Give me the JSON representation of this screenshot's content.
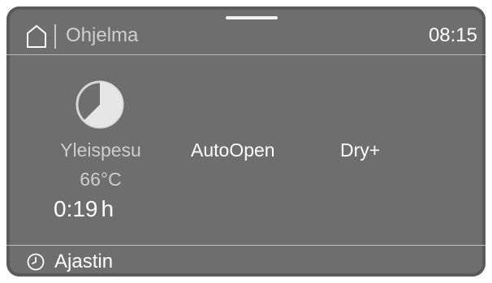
{
  "header": {
    "title": "Ohjelma",
    "time": "08:15",
    "home_icon": "home-icon"
  },
  "program": {
    "icon": "partial-pie-icon",
    "name": "Yleispesu",
    "temperature": "66°C",
    "duration": "0:19",
    "duration_unit": "h"
  },
  "options": [
    {
      "label": "AutoOpen"
    },
    {
      "label": "Dry+"
    }
  ],
  "footer": {
    "icon": "clock-icon",
    "label": "Ajastin"
  },
  "colors": {
    "screen_bg": "#6e6e6e",
    "text_primary": "#ffffff",
    "text_dim": "#cdcdcd",
    "divider": "#bdbdbd"
  }
}
